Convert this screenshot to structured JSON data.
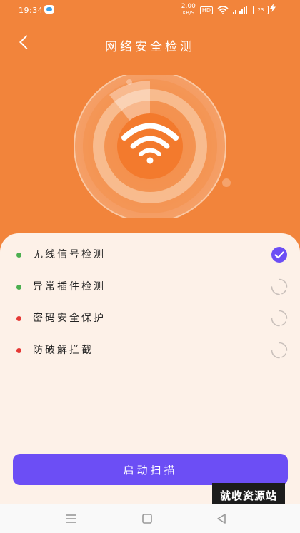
{
  "status_bar": {
    "time": "19:34",
    "speed_value": "2.00",
    "speed_unit": "KB/S",
    "hd_badge": "HD",
    "battery": "23"
  },
  "header": {
    "title": "网络安全检测"
  },
  "checks": [
    {
      "label": "无线信号检测",
      "dot_color": "#4caf50",
      "status": "done"
    },
    {
      "label": "异常插件检测",
      "dot_color": "#4caf50",
      "status": "pending"
    },
    {
      "label": "密码安全保护",
      "dot_color": "#e53935",
      "status": "pending"
    },
    {
      "label": "防破解拦截",
      "dot_color": "#e53935",
      "status": "pending"
    }
  ],
  "start_button_label": "启动扫描",
  "watermark": "就收资源站",
  "colors": {
    "header_bg": "#f2843b",
    "panel_bg": "#fdf1e8",
    "accent": "#6c4ef5"
  }
}
